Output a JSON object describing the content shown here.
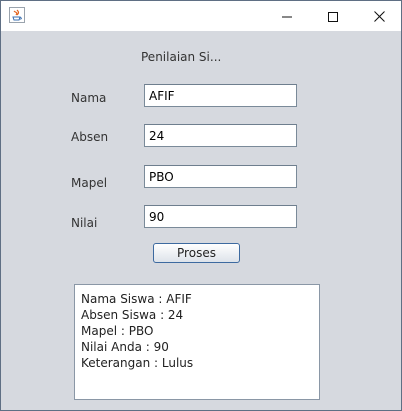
{
  "window": {
    "title": "",
    "icon": "java-icon",
    "controls": [
      "minimize-icon",
      "maximize-icon",
      "close-icon"
    ]
  },
  "form": {
    "heading": "Penilaian Si...",
    "fields": {
      "nama": {
        "label": "Nama",
        "value": "AFIF"
      },
      "absen": {
        "label": "Absen",
        "value": "24"
      },
      "mapel": {
        "label": "Mapel",
        "value": "PBO"
      },
      "nilai": {
        "label": "Nilai",
        "value": "90"
      }
    },
    "button_label": "Proses"
  },
  "result": {
    "lines": [
      "Nama Siswa : AFIF",
      "Absen Siswa : 24",
      "Mapel : PBO",
      "Nilai Anda : 90",
      "Keterangan : Lulus"
    ]
  }
}
